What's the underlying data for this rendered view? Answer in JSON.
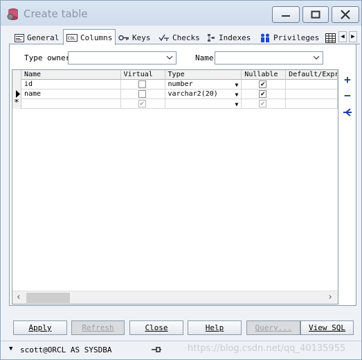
{
  "window": {
    "title": "Create table"
  },
  "tabs": [
    {
      "label": "General",
      "icon": "general-icon"
    },
    {
      "label": "Columns",
      "icon": "columns-icon"
    },
    {
      "label": "Keys",
      "icon": "keys-icon"
    },
    {
      "label": "Checks",
      "icon": "checks-icon"
    },
    {
      "label": "Indexes",
      "icon": "indexes-icon"
    },
    {
      "label": "Privileges",
      "icon": "privileges-icon"
    }
  ],
  "type_owner": {
    "label": "Type owner",
    "value": ""
  },
  "name_field": {
    "label": "Name",
    "value": ""
  },
  "grid": {
    "headers": [
      "Name",
      "Virtual",
      "Type",
      "Nullable",
      "Default/Expr"
    ],
    "rows": [
      {
        "name": "id",
        "virtual": false,
        "type": "number",
        "nullable": true
      },
      {
        "name": "name",
        "virtual": false,
        "type": "varchar2(20)",
        "nullable": true
      },
      {
        "name": "",
        "virtual": true,
        "type": "",
        "nullable": true,
        "new": true
      }
    ]
  },
  "buttons": {
    "apply": "Apply",
    "refresh": "Refresh",
    "close": "Close",
    "help": "Help",
    "query": "Query...",
    "view_sql": "View SQL"
  },
  "status": {
    "connection": "scott@ORCL AS SYSDBA"
  },
  "watermark": "https://blog.csdn.net/qq_40135955"
}
